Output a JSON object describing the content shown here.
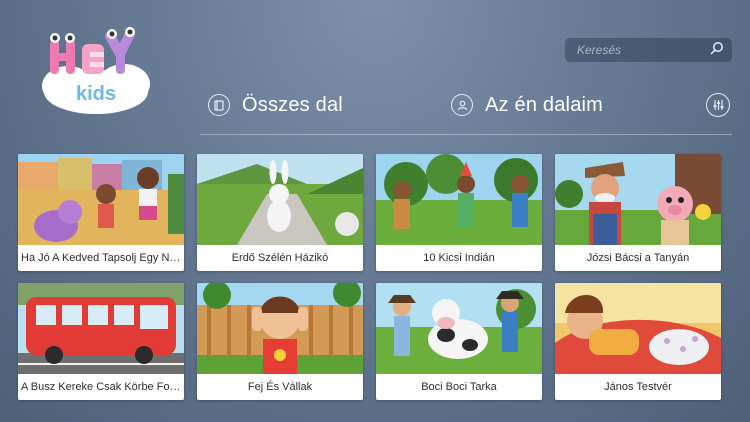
{
  "app": {
    "logo_text_top": "HEY",
    "logo_text_bottom": "kids"
  },
  "search": {
    "placeholder": "Keresés",
    "icon": "search-icon"
  },
  "nav": {
    "all_songs": {
      "label": "Összes dal",
      "icon": "book-icon"
    },
    "my_songs": {
      "label": "Az én dalaim",
      "icon": "user-icon"
    },
    "settings": {
      "icon": "sliders-icon"
    }
  },
  "songs": [
    {
      "title": "Ha Jó A Kedved Tapsolj Egy Nag..."
    },
    {
      "title": "Erdő Szélén Házikó"
    },
    {
      "title": "10 Kicsi Indián"
    },
    {
      "title": "Józsi Bácsi a Tanyán"
    },
    {
      "title": "A Busz Kereke Csak Körbe Forog"
    },
    {
      "title": "Fej És Vállak"
    },
    {
      "title": "Boci Boci Tarka"
    },
    {
      "title": "János Testvér"
    }
  ]
}
